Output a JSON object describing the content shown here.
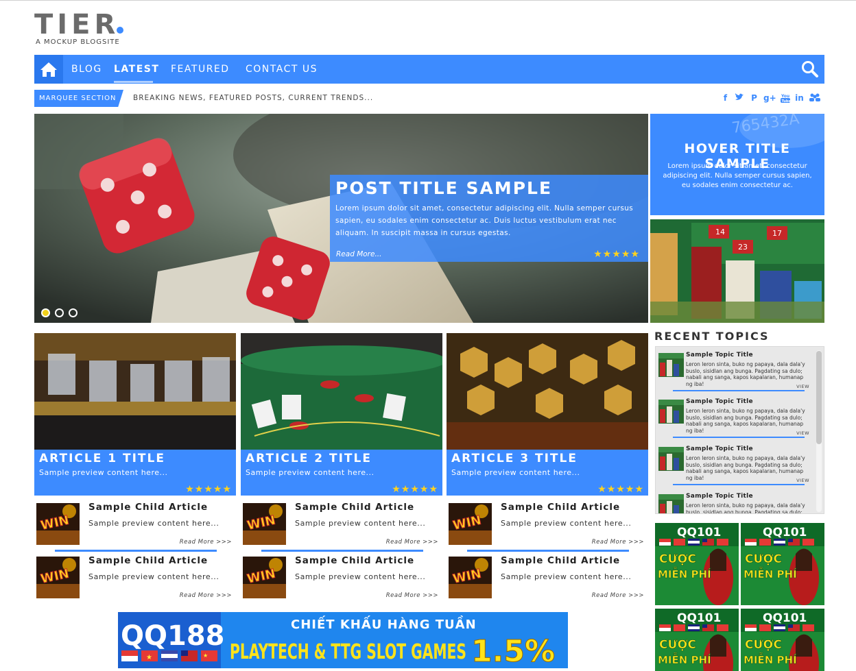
{
  "brand": {
    "logo_text": "TIER",
    "tagline": "A MOCKUP BLOGSITE",
    "accent": "#3d8bff"
  },
  "nav": {
    "home_icon": "home-icon",
    "items": [
      {
        "label": "BLOG"
      },
      {
        "label": "LATEST",
        "active": true
      },
      {
        "label": "FEATURED"
      },
      {
        "label": "CONTACT US"
      }
    ],
    "search_icon": "search-icon"
  },
  "marquee": {
    "tag": "MARQUEE SECTION",
    "text": "BREAKING NEWS, FEATURED POSTS, CURRENT TRENDS..."
  },
  "social": [
    "facebook-icon",
    "twitter-icon",
    "pinterest-icon",
    "google-plus-icon",
    "youtube-icon",
    "linkedin-icon",
    "group-icon"
  ],
  "hero": {
    "title": "POST TITLE SAMPLE",
    "text": "Lorem ipsum dolor sit amet, consectetur adipiscing elit. Nulla semper cursus sapien, eu sodales enim consectetur ac. Duis luctus vestibulum erat nec aliquam. In suscipit massa in cursus egestas.",
    "read_more": "Read More...",
    "stars": "★★★★★",
    "slides": 3,
    "active_slide": 1
  },
  "hover_card": {
    "title": "HOVER TITLE SAMPLE",
    "text": "Lorem ipsum dolor sit amet, consectetur adipiscing elit. Nulla semper cursus sapien, eu sodales enim consectetur ac."
  },
  "articles": [
    {
      "title": "ARTICLE 1 TITLE",
      "preview": "Sample preview content here...",
      "stars": "★★★★★"
    },
    {
      "title": "ARTICLE 2 TITLE",
      "preview": "Sample preview content here...",
      "stars": "★★★★★"
    },
    {
      "title": "ARTICLE 3 TITLE",
      "preview": "Sample preview content here...",
      "stars": "★★★★★"
    }
  ],
  "child_article": {
    "title": "Sample Child Article",
    "preview": "Sample preview content here...",
    "read_more": "Read More >>>",
    "thumb_text": "WIN"
  },
  "banner": {
    "logo": "QQ188",
    "headline": "CHIẾT KHẤU HÀNG TUẦN",
    "subline": "PLAYTECH & TTG SLOT GAMES",
    "percent": "1.5%"
  },
  "recent": {
    "heading": "RECENT TOPICS",
    "topic_title": "Sample Topic Title",
    "topic_text": "Leron leron sinta, buko ng papaya, dala dala'y buslo, sisidlan ang bunga. Pagdating sa dulo; nabali ang sanga, kapos kapalaran, humanap ng iba!",
    "view": "VIEW"
  },
  "side_ads": {
    "logo": "QQ101",
    "line1": "CƯỢC",
    "line2": "MIỄN PHÍ"
  }
}
